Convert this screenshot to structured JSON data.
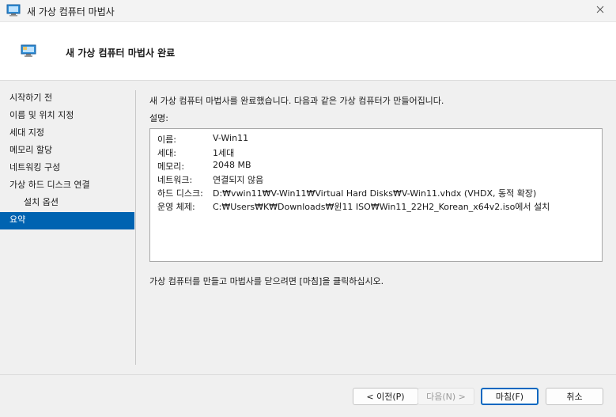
{
  "window": {
    "title": "새 가상 컴퓨터 마법사",
    "icon": "vm-window-icon",
    "close_icon": "close-icon"
  },
  "header": {
    "title": "새 가상 컴퓨터 마법사 완료",
    "icon": "vm-monitor-icon"
  },
  "nav": {
    "items": [
      {
        "label": "시작하기 전"
      },
      {
        "label": "이름 및 위치 지정"
      },
      {
        "label": "세대 지정"
      },
      {
        "label": "메모리 할당"
      },
      {
        "label": "네트워킹 구성"
      },
      {
        "label": "가상 하드 디스크 연결"
      },
      {
        "label": "설치 옵션"
      },
      {
        "label": "요약"
      }
    ],
    "selected": "요약"
  },
  "main": {
    "intro": "새 가상 컴퓨터 마법사를 완료했습니다. 다음과 같은 가상 컴퓨터가 만들어집니다.",
    "description_label": "설명:",
    "summary": [
      {
        "label": "이름:",
        "value": "V-Win11"
      },
      {
        "label": "세대:",
        "value": "1세대"
      },
      {
        "label": "메모리:",
        "value": "2048 MB"
      },
      {
        "label": "네트워크:",
        "value": "연결되지 않음"
      },
      {
        "label": "하드 디스크:",
        "value": "D:₩vwin11₩V-Win11₩Virtual Hard Disks₩V-Win11.vhdx (VHDX, 동적 확장)"
      },
      {
        "label": "운영 체제:",
        "value": "C:₩Users₩K₩Downloads₩윈11 ISO₩Win11_22H2_Korean_x64v2.iso에서 설치"
      }
    ],
    "finish_note": "가상 컴퓨터를 만들고 마법사를 닫으려면 [마침]을 클릭하십시오."
  },
  "buttons": {
    "previous": "< 이전(P)",
    "next": "다음(N) >",
    "finish": "마침(F)",
    "cancel": "취소"
  },
  "colors": {
    "selection": "#0063b1",
    "primary_border": "#0067c0"
  }
}
